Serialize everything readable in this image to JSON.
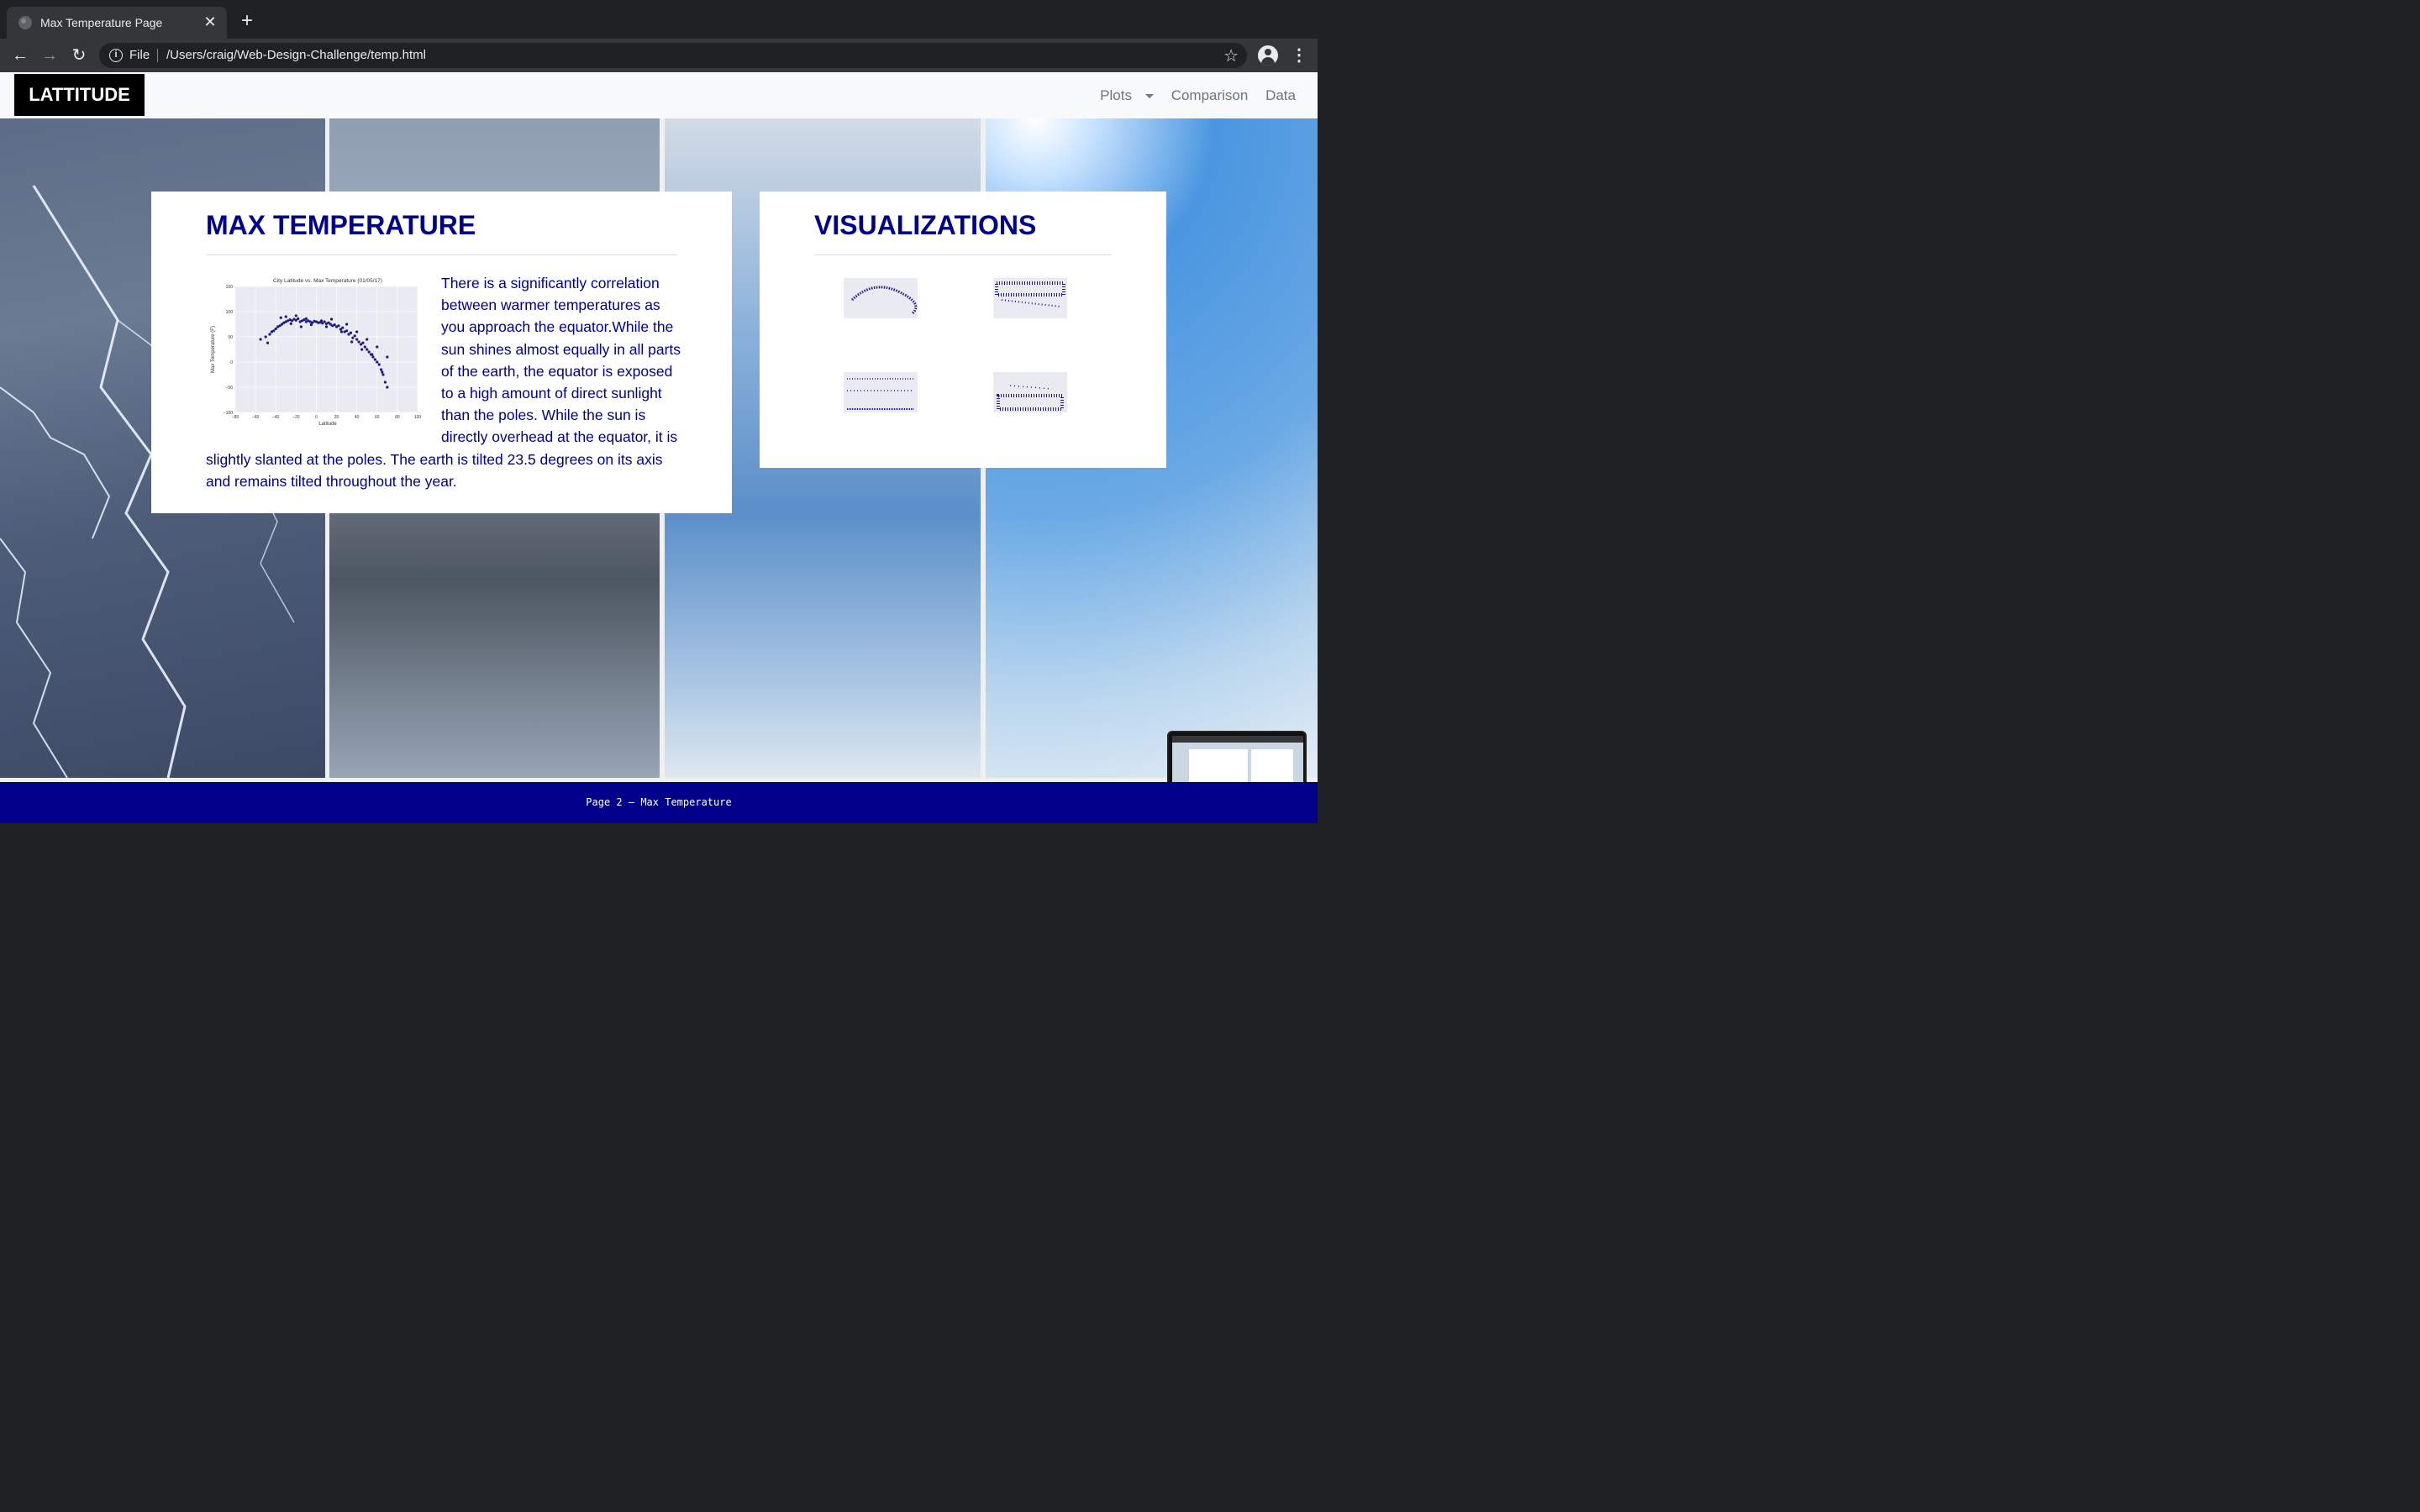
{
  "browser": {
    "tab_title": "Max Temperature Page",
    "close_glyph": "✕",
    "new_tab_glyph": "+",
    "back_glyph": "←",
    "forward_glyph": "→",
    "reload_glyph": "↻",
    "info_glyph": "i",
    "scheme_label": "File",
    "url": "/Users/craig/Web-Design-Challenge/temp.html",
    "star_glyph": "☆",
    "menu_glyph": "⋮"
  },
  "navbar": {
    "brand": "LATTITUDE",
    "links": [
      "Plots",
      "Comparison",
      "Data"
    ]
  },
  "main_card": {
    "title": "MAX TEMPERATURE",
    "description": "There is a significantly correlation between warmer temperatures as you approach the equator.While the sun shines almost equally in all parts of the earth, the equator is exposed to a high amount of direct sunlight than the poles. While the sun is directly overhead at the equator, it is slightly slanted at the poles. The earth is tilted 23.5 degrees on its axis and remains tilted throughout the year."
  },
  "vis_card": {
    "title": "VISUALIZATIONS"
  },
  "footer": {
    "text": "Page 2 – Max Temperature"
  },
  "colors": {
    "accent": "#00008b",
    "brand_bg": "#000000",
    "footer_bg": "#00008b"
  },
  "chart_data": {
    "type": "scatter",
    "title": "City Latitude vs. Max Temperature (01/05/17)",
    "xlabel": "Latitude",
    "ylabel": "Max Temperature (F)",
    "xlim": [
      -80,
      100
    ],
    "ylim": [
      -100,
      150
    ],
    "xticks": [
      -80,
      -60,
      -40,
      -20,
      0,
      20,
      40,
      60,
      80,
      100
    ],
    "yticks": [
      -100,
      -50,
      0,
      50,
      100,
      150
    ],
    "grid": true,
    "series": [
      {
        "x": [
          -55,
          -50,
          -46,
          -42,
          -40,
          -38,
          -36,
          -34,
          -32,
          -30,
          -28,
          -26,
          -24,
          -22,
          -20,
          -18,
          -16,
          -14,
          -12,
          -10,
          -8,
          -6,
          -4,
          -2,
          0,
          2,
          4,
          6,
          8,
          10,
          12,
          14,
          16,
          18,
          20,
          22,
          24,
          26,
          28,
          30,
          32,
          34,
          36,
          38,
          40,
          42,
          44,
          46,
          48,
          50,
          52,
          54,
          56,
          58,
          60,
          62,
          64,
          66,
          68,
          70,
          -48,
          -44,
          -35,
          -30,
          -25,
          -20,
          -15,
          -10,
          -5,
          5,
          10,
          15,
          25,
          30,
          35,
          40,
          45,
          50,
          55,
          60,
          65,
          70
        ],
        "y": [
          45,
          50,
          55,
          62,
          66,
          70,
          72,
          75,
          78,
          80,
          82,
          84,
          82,
          85,
          83,
          86,
          80,
          82,
          84,
          80,
          82,
          80,
          78,
          81,
          80,
          78,
          79,
          77,
          80,
          76,
          78,
          75,
          72,
          74,
          70,
          72,
          65,
          68,
          60,
          62,
          55,
          58,
          48,
          52,
          45,
          40,
          35,
          38,
          30,
          25,
          20,
          15,
          10,
          5,
          0,
          -5,
          -15,
          -25,
          -40,
          -50,
          38,
          60,
          88,
          90,
          76,
          92,
          70,
          86,
          74,
          82,
          70,
          85,
          60,
          75,
          40,
          60,
          25,
          45,
          15,
          30,
          -20,
          10
        ]
      }
    ]
  }
}
